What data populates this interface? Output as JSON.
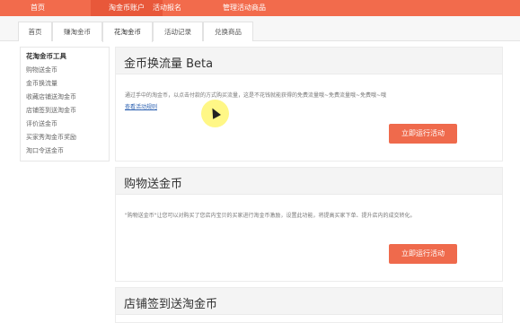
{
  "topnav": {
    "items": [
      "首页",
      "淘金币账户",
      "活动报名",
      "管理活动商品"
    ],
    "active": 1
  },
  "subtabs": {
    "items": [
      "首页",
      "赚淘金币",
      "花淘金币",
      "活动记录",
      "兑换商品"
    ],
    "active": 2
  },
  "sidebar": {
    "title": "花淘金币工具",
    "links": [
      "购物送金币",
      "金币换流量",
      "收藏店铺送淘金币",
      "店铺签到送淘金币",
      "评价送金币",
      "买家秀淘金币奖励",
      "淘口令送金币"
    ]
  },
  "panels": [
    {
      "title": "金币换流量 Beta",
      "desc": "通过手中的淘金币，以点击付款的方式购买流量，这是不花钱就能获得的免费流量哦~免费流量哦~免费哦~哦",
      "more": "查看活动规则",
      "button": "立即运行活动"
    },
    {
      "title": "购物送金币",
      "desc": "\"购物送金币\"让您可以对购买了您店内宝贝的买家进行淘金币激励，设置此功能，将提高买家下单、提升店内的成交转化。",
      "button": "立即运行活动"
    },
    {
      "title": "店铺签到送淘金币"
    }
  ],
  "colors": {
    "brand": "#f26b4c",
    "button": "#ef6a4c",
    "link": "#2a5fb0",
    "highlight": "#fff564"
  }
}
